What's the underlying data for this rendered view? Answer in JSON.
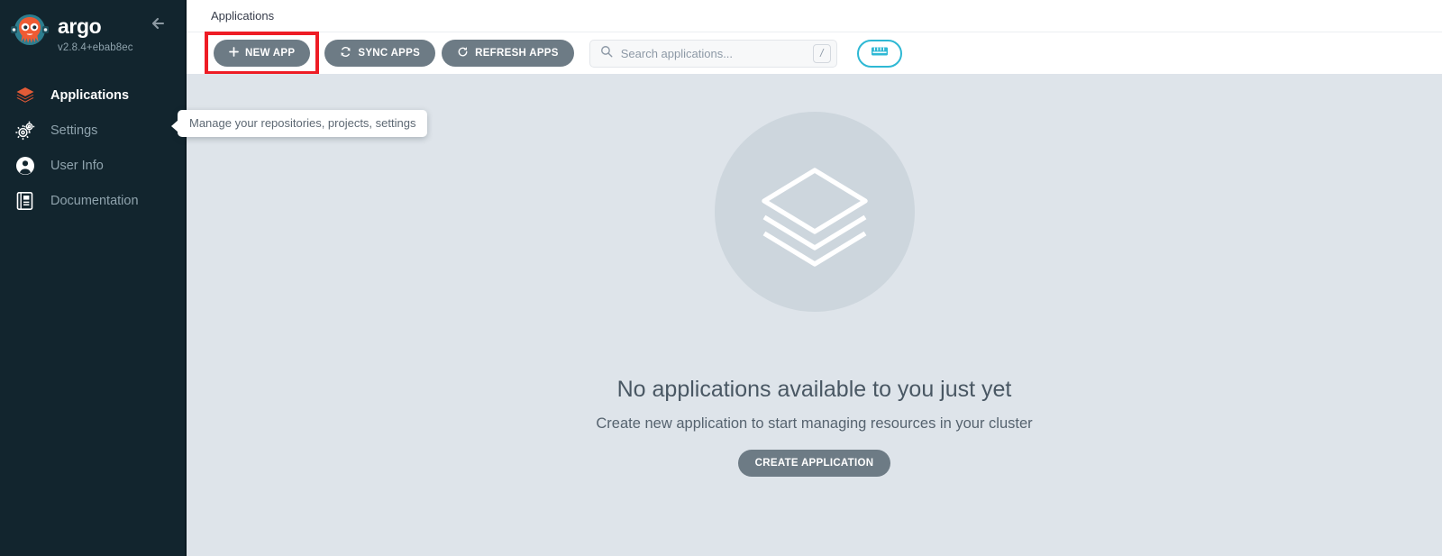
{
  "sidebar": {
    "brand_name": "argo",
    "version": "v2.8.4+ebab8ec",
    "collapse_label": "collapse-sidebar",
    "items": [
      {
        "label": "Applications",
        "icon": "layers-icon",
        "active": true
      },
      {
        "label": "Settings",
        "icon": "gears-icon",
        "active": false
      },
      {
        "label": "User Info",
        "icon": "user-circle-icon",
        "active": false
      },
      {
        "label": "Documentation",
        "icon": "book-icon",
        "active": false
      }
    ]
  },
  "header": {
    "breadcrumb": "Applications"
  },
  "toolbar": {
    "new_app_label": "NEW APP",
    "new_app_icon": "plus-icon",
    "sync_apps_label": "SYNC APPS",
    "sync_apps_icon": "sync-icon",
    "refresh_apps_label": "REFRESH APPS",
    "refresh_apps_icon": "refresh-icon",
    "search": {
      "placeholder": "Search applications...",
      "value": "",
      "icon": "search-icon",
      "shortcut_key": "/"
    },
    "view_toggle_icon": "list-view-icon",
    "highlight_color": "#ee1c25",
    "accent_color": "#2eb8d4",
    "button_color": "#6d7b85"
  },
  "tooltip": {
    "text": "Manage your repositories, projects, settings"
  },
  "empty_state": {
    "icon": "stacked-layers-icon",
    "title": "No applications available to you just yet",
    "subtitle": "Create new application to start managing resources in your cluster",
    "button_label": "CREATE APPLICATION"
  }
}
